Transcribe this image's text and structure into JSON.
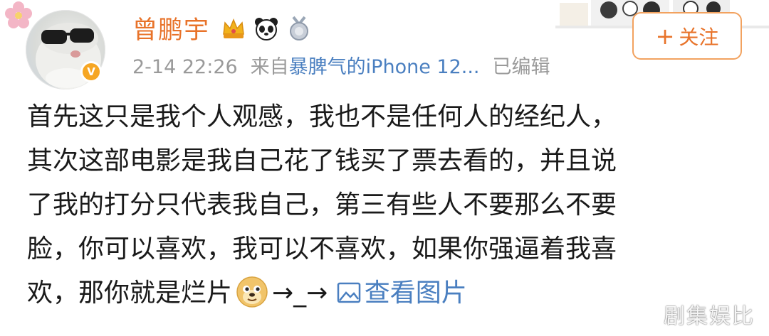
{
  "post": {
    "username": "曾鹏宇",
    "timestamp": "2-14 22:26",
    "source_prefix": "来自",
    "source": "暴脾气的iPhone 12...",
    "edited": "已编辑",
    "follow_label": "关注",
    "follow_plus": "+",
    "badges": [
      "crown-badge-icon",
      "panda-badge-icon",
      "medal-badge-icon"
    ],
    "content_lines": [
      "首先这只是我个人观感，我也不是任何人的经纪人，",
      "其次这部电影是我自己花了钱买了票去看的，并且说",
      "了我的打分只代表我自己，第三有些人不要那么不要",
      "脸，你可以喜欢，我可以不喜欢，如果你强逼着我喜"
    ],
    "last_line_text": "欢，那你就是烂片",
    "last_line_tail": "→_→",
    "view_image_label": "查看图片"
  },
  "watermark": "剧集娱比",
  "colors": {
    "username": "#e8732a",
    "link": "#4a7fc0",
    "meta": "#9a9a9a",
    "follow_border": "#f2a25f",
    "text": "#1a1a1a"
  }
}
